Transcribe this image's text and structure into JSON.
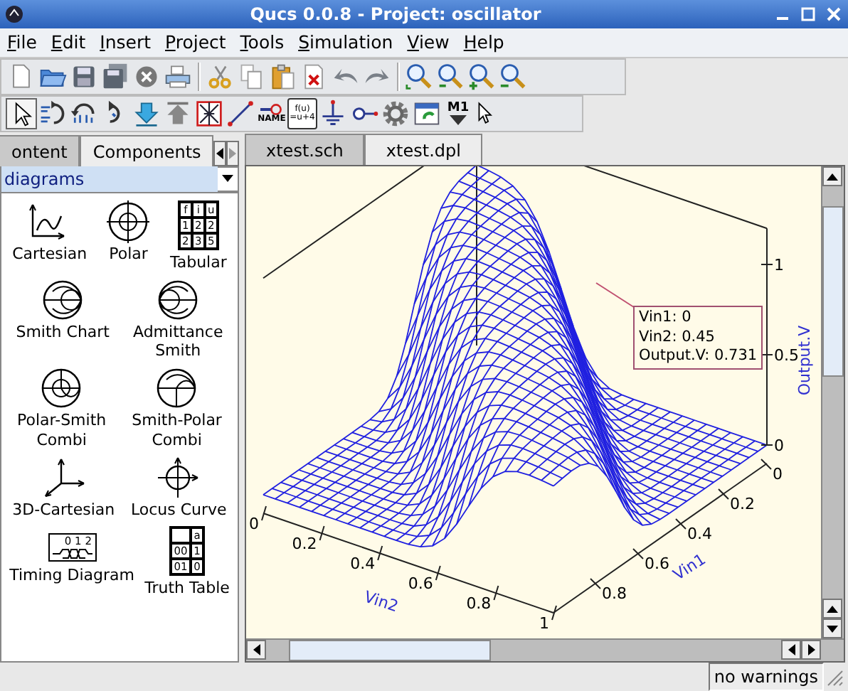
{
  "window": {
    "title": "Qucs 0.0.8 - Project: oscillator"
  },
  "menu": [
    {
      "accel": "F",
      "rest": "ile"
    },
    {
      "accel": "E",
      "rest": "dit"
    },
    {
      "accel": "I",
      "rest": "nsert"
    },
    {
      "accel": "P",
      "rest": "roject"
    },
    {
      "accel": "T",
      "rest": "ools"
    },
    {
      "accel": "S",
      "rest": "imulation"
    },
    {
      "accel": "V",
      "rest": "iew"
    },
    {
      "accel": "H",
      "rest": "elp"
    }
  ],
  "toolbar_1": [
    {
      "kind": "new"
    },
    {
      "kind": "open"
    },
    {
      "kind": "save"
    },
    {
      "kind": "saveall"
    },
    {
      "kind": "close"
    },
    {
      "kind": "print"
    },
    {
      "kind": "sep"
    },
    {
      "kind": "cut"
    },
    {
      "kind": "copy"
    },
    {
      "kind": "paste"
    },
    {
      "kind": "delete"
    },
    {
      "kind": "undo"
    },
    {
      "kind": "redo"
    },
    {
      "kind": "sep"
    },
    {
      "kind": "zoomfit"
    },
    {
      "kind": "zoom11"
    },
    {
      "kind": "zoomin"
    },
    {
      "kind": "zoomout"
    }
  ],
  "toolbar_2": [
    {
      "kind": "select",
      "pressed": true
    },
    {
      "kind": "mirrorx",
      "pressed": false
    },
    {
      "kind": "mirrory",
      "pressed": false
    },
    {
      "kind": "rotate",
      "pressed": false
    },
    {
      "kind": "enter",
      "pressed": false
    },
    {
      "kind": "exit",
      "pressed": false
    },
    {
      "kind": "deactivate",
      "pressed": false
    },
    {
      "kind": "wire",
      "pressed": false
    },
    {
      "kind": "label",
      "text": "NAME",
      "pressed": false
    },
    {
      "kind": "equation",
      "lines": [
        "f(u)",
        "=u+4"
      ],
      "pressed": false
    },
    {
      "kind": "ground",
      "pressed": false
    },
    {
      "kind": "port",
      "pressed": false
    },
    {
      "kind": "simulate",
      "pressed": false
    },
    {
      "kind": "dataview",
      "pressed": false
    },
    {
      "kind": "marker",
      "text": "M1",
      "pressed": false
    },
    {
      "kind": "help",
      "pressed": false
    }
  ],
  "side_tabs": [
    {
      "label": "ontent",
      "selected": false
    },
    {
      "label": "Components",
      "selected": true
    }
  ],
  "component_group": {
    "value": "diagrams"
  },
  "components": [
    {
      "kind": "cartesian",
      "lines": [
        "Cartesian"
      ]
    },
    {
      "kind": "polar",
      "lines": [
        "Polar"
      ]
    },
    {
      "kind": "tabular",
      "lines": [
        "Tabular"
      ],
      "icon_text": [
        "f",
        "i",
        "u",
        "1",
        "2",
        "2",
        "2",
        "3",
        "5"
      ]
    },
    {
      "kind": "smith",
      "lines": [
        "Smith Chart"
      ]
    },
    {
      "kind": "admittance",
      "lines": [
        "Admittance",
        "Smith"
      ]
    },
    {
      "kind": "polarsmith",
      "lines": [
        "Polar-Smith",
        "Combi"
      ]
    },
    {
      "kind": "smithpolar",
      "lines": [
        "Smith-Polar",
        "Combi"
      ]
    },
    {
      "kind": "cart3d",
      "lines": [
        "3D-Cartesian"
      ]
    },
    {
      "kind": "locus",
      "lines": [
        "Locus Curve"
      ]
    },
    {
      "kind": "timing",
      "lines": [
        "Timing Diagram"
      ],
      "icon_text": [
        "0 1 2"
      ]
    },
    {
      "kind": "truth",
      "lines": [
        "Truth Table"
      ],
      "icon_text": [
        "a",
        "00",
        "1",
        "01",
        "0"
      ]
    }
  ],
  "doc_tabs": [
    {
      "label": "xtest.sch",
      "selected": false
    },
    {
      "label": "xtest.dpl",
      "selected": true
    }
  ],
  "plot": {
    "z_label": "Output.V",
    "z_ticks": [
      "1",
      "0.5",
      "0"
    ],
    "vin1_label": "Vin1",
    "vin1_ticks": [
      "0",
      "0.2",
      "0.4",
      "0.6",
      "0.8"
    ],
    "vin2_label": "Vin2",
    "vin2_ticks": [
      "0",
      "0.2",
      "0.4",
      "0.6",
      "0.8",
      "1"
    ],
    "marker": {
      "lines": [
        "Vin1: 0",
        "Vin2: 0.45",
        "Output.V: 0.731"
      ]
    }
  },
  "status_bar": {
    "message": "no warnings"
  }
}
